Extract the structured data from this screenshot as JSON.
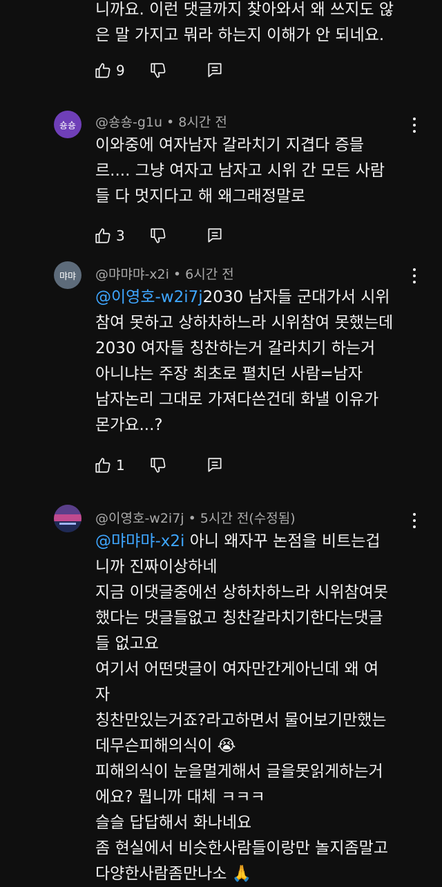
{
  "comments": [
    {
      "body_lines": [
        "니까요. 이런 댓글까지 찾아와서 왜 쓰지도 않",
        "은 말 가지고 뭐라 하는지 이해가 안 되네요."
      ],
      "likes": "9"
    },
    {
      "avatar_text": "숑숑",
      "avatar_color": "#6f3fb8",
      "author": "@숑숑-g1u",
      "time": "8시간 전",
      "body_lines": [
        "이와중에 여자남자 갈라치기 지겹다 증믈",
        "르.... 그냥 여자고 남자고 시위 간 모든 사람",
        "들 다 멋지다고 해 왜그래정말로"
      ],
      "likes": "3"
    },
    {
      "avatar_text": "먀먀",
      "avatar_color": "#5d6b7a",
      "author": "@먀먀먀-x2i",
      "time": "6시간 전",
      "mention": "@이영호-w2i7j",
      "body_first_rest": "2030 남자들 군대가서 시위",
      "body_lines": [
        "참여 못하고 상하차하느라 시위참여 못했는데",
        "2030 여자들 칭찬하는거 갈라치기 하는거",
        "아니냐는 주장 최초로 펼치던 사람=남자",
        "남자논리 그대로 가져다쓴건데 화낼 이유가",
        "몬가요...?"
      ],
      "likes": "1"
    },
    {
      "avatar_color": "#3a2a4f",
      "author": "@이영호-w2i7j",
      "time": "5시간 전(수정됨)",
      "mention": "@먀먀먀-x2i",
      "body_first_rest": " 아니  왜자꾸 논점을 비트는겁",
      "body_lines": [
        "니까 진짜이상하네",
        "지금 이댓글중에선 상하차하느라 시위참여못",
        "했다는 댓글들없고 칭찬갈라치기한다는댓글",
        "들 없고요",
        " 여기서 어떤댓글이 여자만간게아닌데 왜 여",
        "자",
        "칭찬만있는거죠?라고하면서 물어보기만했는",
        "데무슨피해의식이 😭",
        "피해의식이 눈을멀게해서 글을못읽게하는거",
        "에요? 뭡니까 대체   ㅋㅋㅋ",
        "슬슬 답답해서 화나네요",
        "좀 현실에서 비슷한사람들이랑만 놀지좀말고",
        "다양한사람좀만나소 🙏"
      ]
    }
  ],
  "icons": {
    "like": "thumbs-up-icon",
    "dislike": "thumbs-down-icon",
    "reply": "reply-icon",
    "more": "more-vertical-icon"
  },
  "colors": {
    "background": "#0f0f0f",
    "text": "#f1f1f1",
    "meta": "#aaaaaa",
    "mention": "#3ea6ff"
  }
}
